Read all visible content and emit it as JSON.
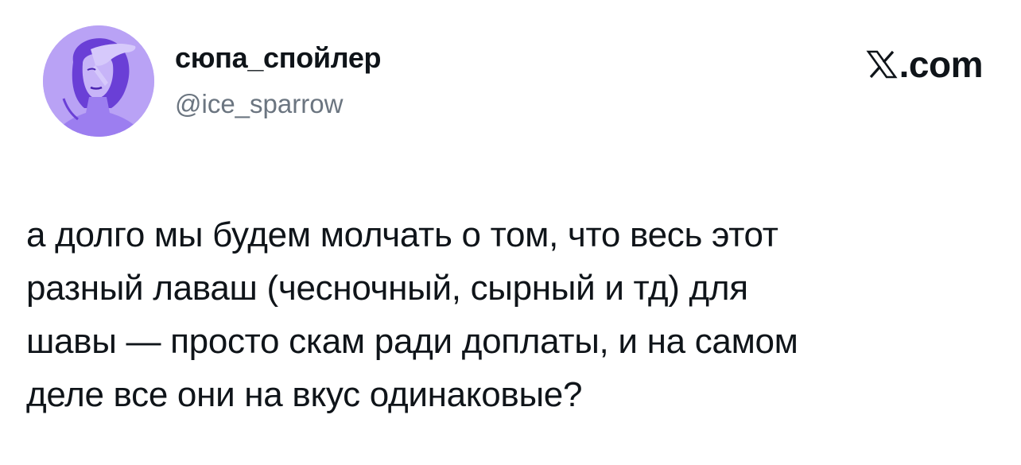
{
  "author": {
    "display_name": "сюпа_спойлер",
    "handle": "@ice_sparrow",
    "avatar_icon": "profile-avatar-purple-portrait"
  },
  "brand": {
    "logo_icon": "x-logo-icon",
    "suffix": ".com"
  },
  "tweet": {
    "text": "а долго мы будем молчать о том, что весь этот\nразный лаваш (чесночный, сырный и тд) для\nшавы — просто скам ради доплаты, и на самом\nделе все они на вкус одинаковые?"
  },
  "colors": {
    "avatar_bg": "#b9a2f5",
    "avatar_figure": "#6a3fd6",
    "text_primary": "#0f1419",
    "text_secondary": "#6b7580"
  }
}
